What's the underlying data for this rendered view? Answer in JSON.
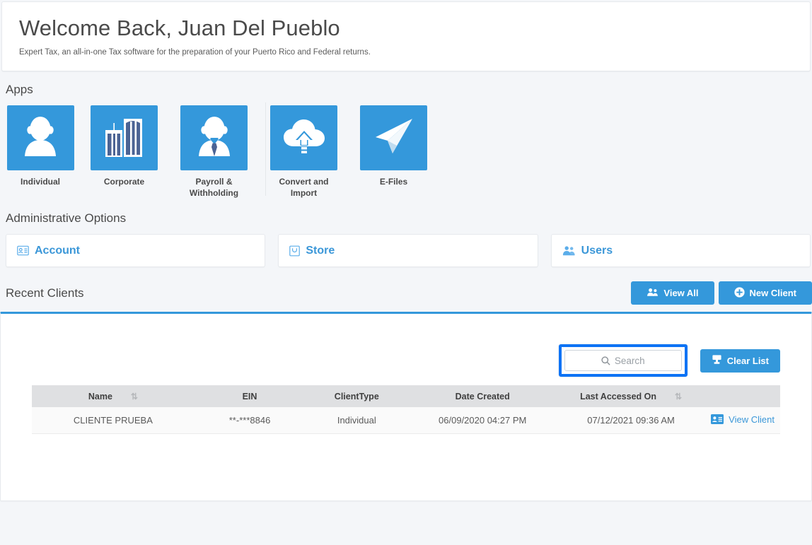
{
  "welcome": {
    "title": "Welcome Back, Juan Del Pueblo",
    "subtitle": "Expert Tax, an all-in-one Tax software for the preparation of your Puerto Rico and Federal returns."
  },
  "apps": {
    "title": "Apps",
    "items": [
      {
        "label": "Individual",
        "icon": "person-icon"
      },
      {
        "label": "Corporate",
        "icon": "buildings-icon"
      },
      {
        "label": "Payroll & Withholding",
        "icon": "person-tie-icon"
      },
      {
        "label": "Convert and Import",
        "icon": "cloud-upload-icon"
      },
      {
        "label": "E-Files",
        "icon": "paper-plane-icon"
      }
    ]
  },
  "admin": {
    "title": "Administrative Options",
    "items": [
      {
        "label": "Account",
        "icon": "id-card-icon"
      },
      {
        "label": "Store",
        "icon": "shopping-bag-icon"
      },
      {
        "label": "Users",
        "icon": "users-icon"
      }
    ]
  },
  "recent": {
    "title": "Recent Clients",
    "view_all_label": "View All",
    "new_client_label": "New Client",
    "clear_list_label": "Clear List",
    "search": {
      "value": "",
      "placeholder": "Search"
    },
    "columns": [
      {
        "label": "Name",
        "sortable": true
      },
      {
        "label": "EIN",
        "sortable": false
      },
      {
        "label": "ClientType",
        "sortable": false
      },
      {
        "label": "Date Created",
        "sortable": false
      },
      {
        "label": "Last Accessed On",
        "sortable": true
      },
      {
        "label": "",
        "sortable": false
      }
    ],
    "rows": [
      {
        "name": "CLIENTE PRUEBA",
        "ein": "**-***8846",
        "client_type": "Individual",
        "date_created": "06/09/2020 04:27 PM",
        "last_accessed": "07/12/2021 09:36 AM",
        "action_label": "View Client"
      }
    ]
  },
  "colors": {
    "accent_blue": "#3498db",
    "link_blue": "#3b97d8",
    "highlight_ring": "#0d73f5",
    "page_background": "#f4f6f9",
    "table_header": "#dfe0e2"
  }
}
